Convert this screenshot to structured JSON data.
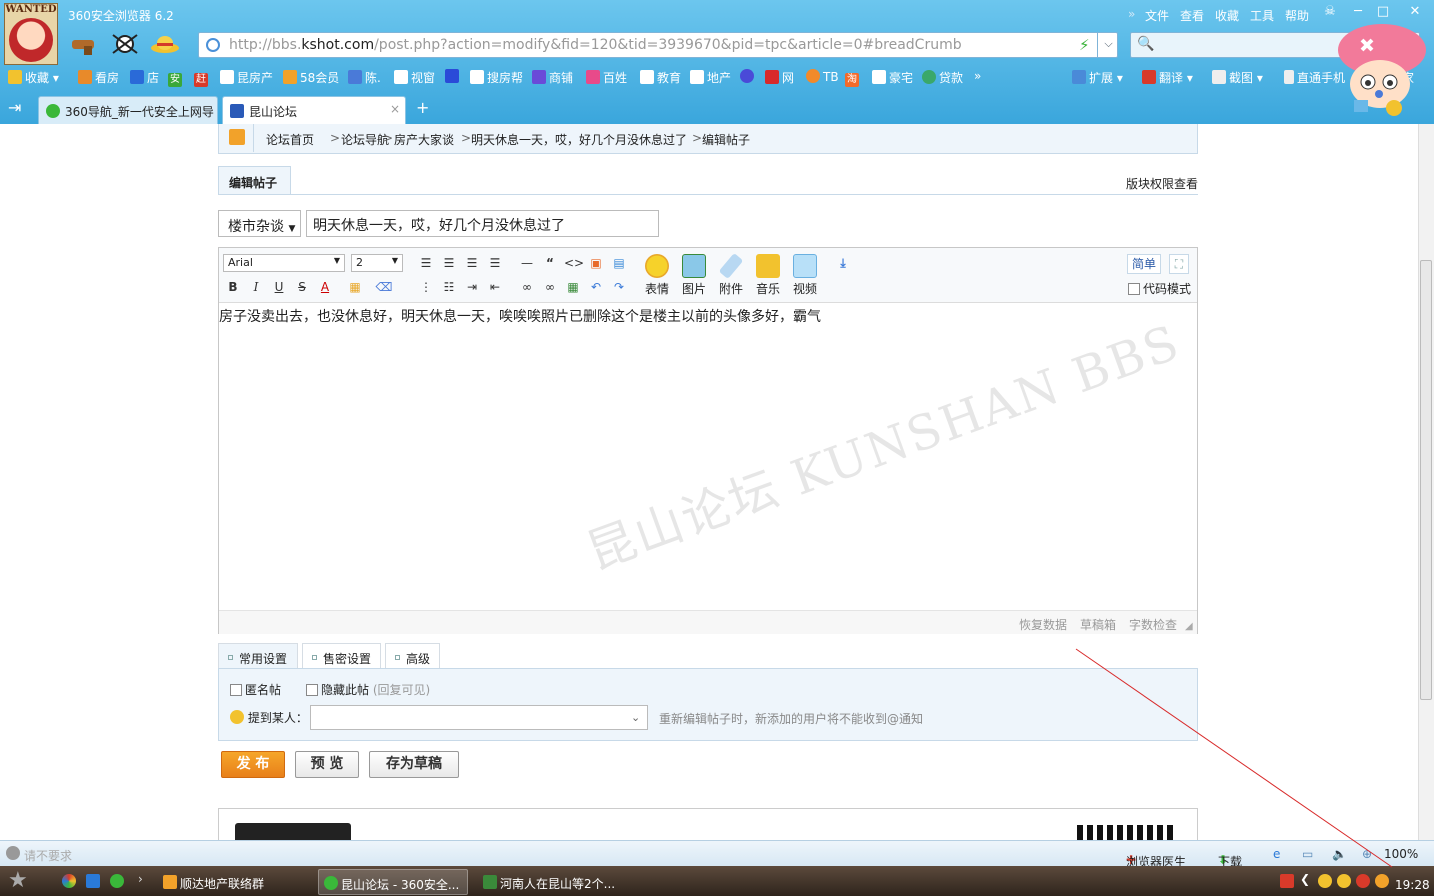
{
  "browser": {
    "title": "360安全浏览器 6.2",
    "logo_text": "WANTED",
    "menu": [
      "文件",
      "查看",
      "收藏",
      "工具",
      "帮助"
    ],
    "window_buttons": [
      "─",
      "□",
      "✕"
    ],
    "url_prefix": "http://bbs.",
    "url_domain": "kshot.com",
    "url_path": "/post.php?action=modify&fid=120&tid=3939670&pid=tpc&article=0#breadCrumb",
    "favorites": [
      "收藏",
      "看房",
      "店",
      "安",
      "赶",
      "昆房产",
      "58会员",
      "陈.",
      "视窗",
      "",
      "搜房帮",
      "商铺",
      "百姓",
      "教育",
      "地产",
      "",
      "网",
      "TB",
      "淘",
      "豪宅",
      "贷款",
      "»"
    ],
    "fav_right": [
      "扩展",
      "翻译",
      "截图",
      "直通手机",
      "管家"
    ],
    "tabs": [
      {
        "label": "360导航_新一代安全上网导"
      },
      {
        "label": "昆山论坛",
        "close": "×"
      }
    ],
    "new_tab": "+"
  },
  "breadcrumb": [
    "论坛首页",
    ">",
    "论坛导航",
    ">",
    "房产大家谈",
    ">",
    "明天休息一天，哎，好几个月没休息过了",
    ">",
    "编辑帖子"
  ],
  "form": {
    "tab_label": "编辑帖子",
    "permission_link": "版块权限查看",
    "type_select": "楼市杂谈",
    "subject": "明天休息一天，哎，好几个月没休息过了",
    "font_family": "Arial",
    "font_size": "2",
    "toolbar_big": [
      "表情",
      "图片",
      "附件",
      "音乐",
      "视频"
    ],
    "simple_btn": "简单",
    "code_mode": "代码模式",
    "content": "房子没卖出去，也没休息好，明天休息一天，唉唉唉照片已删除这个是楼主以前的头像多好，霸气",
    "watermark": "昆山论坛 KUNSHAN BBS",
    "status_links": [
      "恢复数据",
      "草稿箱",
      "字数检查"
    ],
    "settings_tabs": [
      "常用设置",
      "售密设置",
      "高级"
    ],
    "anonymous": "匿名帖",
    "hidden": "隐藏此帖",
    "hidden_note": "(回复可见)",
    "mention_label": "提到某人：",
    "mention_placeholder": "",
    "mention_note": "重新编辑帖子时，新添加的用户将不能收到@通知",
    "publish": "发 布",
    "preview": "预 览",
    "save_draft": "存为草稿"
  },
  "statusbar": {
    "left": "请不要求",
    "doctor": "浏览器医生",
    "download": "下载",
    "zoom": "100%"
  },
  "taskbar": {
    "tasks": [
      "顺达地产联络群",
      "昆山论坛 - 360安全...",
      "河南人在昆山等2个..."
    ],
    "time": "19:28"
  }
}
